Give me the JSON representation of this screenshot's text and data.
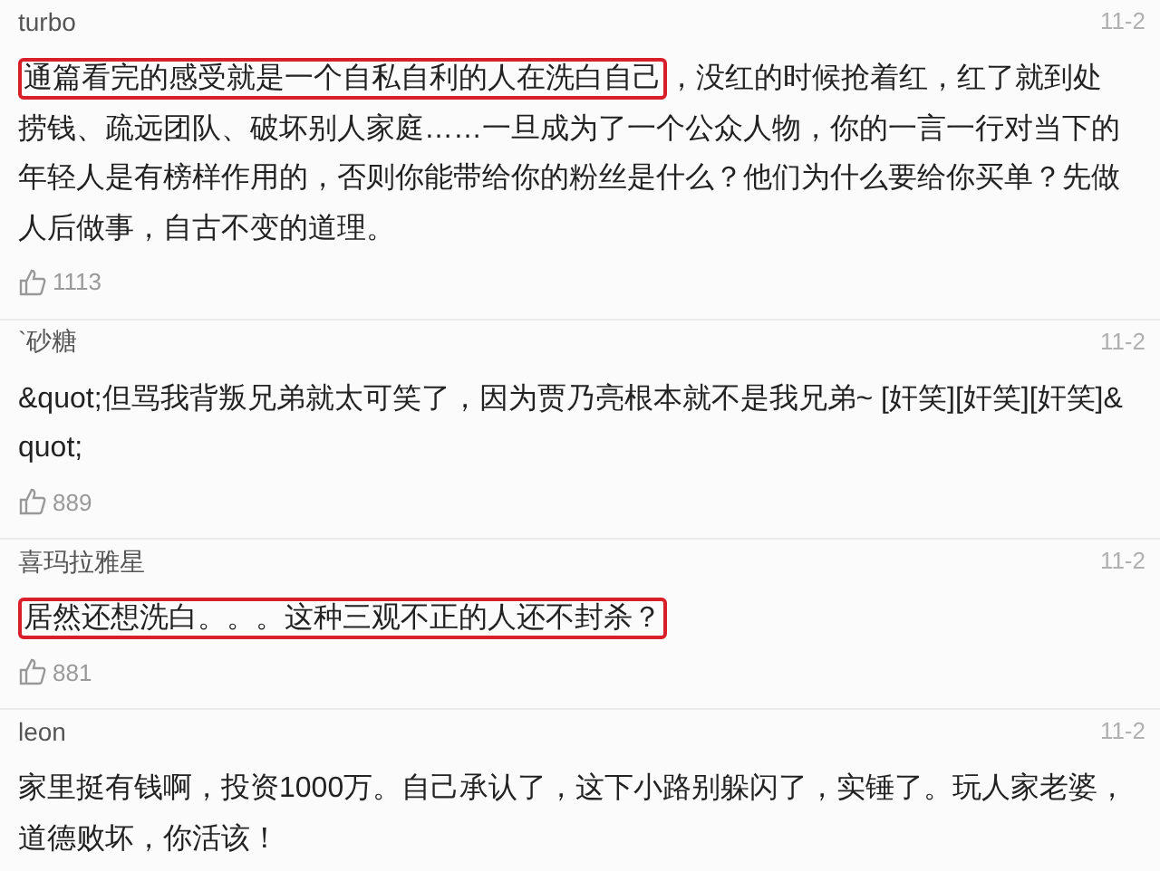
{
  "comments": [
    {
      "user": "turbo",
      "date": "11-2",
      "segments": [
        {
          "text": "通篇看完的感受就是一个自私自利的人在洗白自己",
          "highlighted": true
        },
        {
          "text": "，没红的时候抢着红，红了就到处捞钱、疏远团队、破坏别人家庭……一旦成为了一个公众人物，你的一言一行对当下的年轻人是有榜样作用的，否则你能带给你的粉丝是什么？他们为什么要给你买单？先做人后做事，自古不变的道理。",
          "highlighted": false
        }
      ],
      "likes": "1113"
    },
    {
      "user": "`砂糖",
      "date": "11-2",
      "segments": [
        {
          "text": "&quot;但骂我背叛兄弟就太可笑了，因为贾乃亮根本就不是我兄弟~ [奸笑][奸笑][奸笑]&quot;",
          "highlighted": false
        }
      ],
      "likes": "889"
    },
    {
      "user": "喜玛拉雅星",
      "date": "11-2",
      "segments": [
        {
          "text": "居然还想洗白。。。这种三观不正的人还不封杀？",
          "highlighted": true
        }
      ],
      "likes": "881"
    },
    {
      "user": "leon",
      "date": "11-2",
      "segments": [
        {
          "text": "家里挺有钱啊，投资1000万。自己承认了，这下小路别躲闪了，实锤了。玩人家老婆，道德败坏，你活该！",
          "highlighted": false
        }
      ]
    }
  ]
}
